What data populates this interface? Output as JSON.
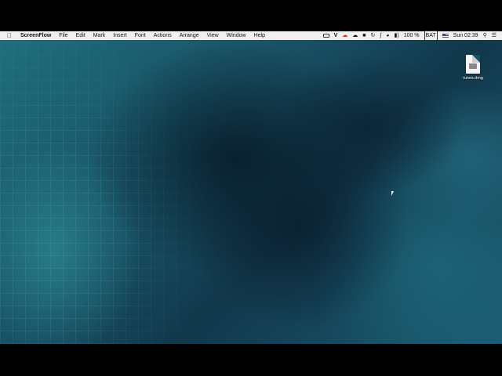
{
  "menubar": {
    "app_name": "ScreenFlow",
    "menus": [
      "File",
      "Edit",
      "Mark",
      "Insert",
      "Font",
      "Actions",
      "Arrange",
      "View",
      "Window",
      "Help"
    ],
    "status": {
      "vpn_letter": "V",
      "battery_percent": "100 %",
      "battery_label": "BAT",
      "clock": "Sun 02:39"
    },
    "icons": [
      "apple-icon",
      "screen-record-icon",
      "vpn-icon",
      "cloud-red-icon",
      "cloud-icon",
      "disk-icon",
      "time-machine-icon",
      "bluetooth-icon",
      "wifi-icon",
      "volume-icon",
      "battery-icon",
      "flag-icon",
      "search-icon",
      "control-center-icon"
    ]
  },
  "desktop": {
    "file": {
      "label": "runes.dmg",
      "icon": "dmg-file-icon"
    }
  },
  "colors": {
    "menubar_bg": "#f0f0f0",
    "water_dark": "#0a2232",
    "water_light": "#2b8a95"
  }
}
